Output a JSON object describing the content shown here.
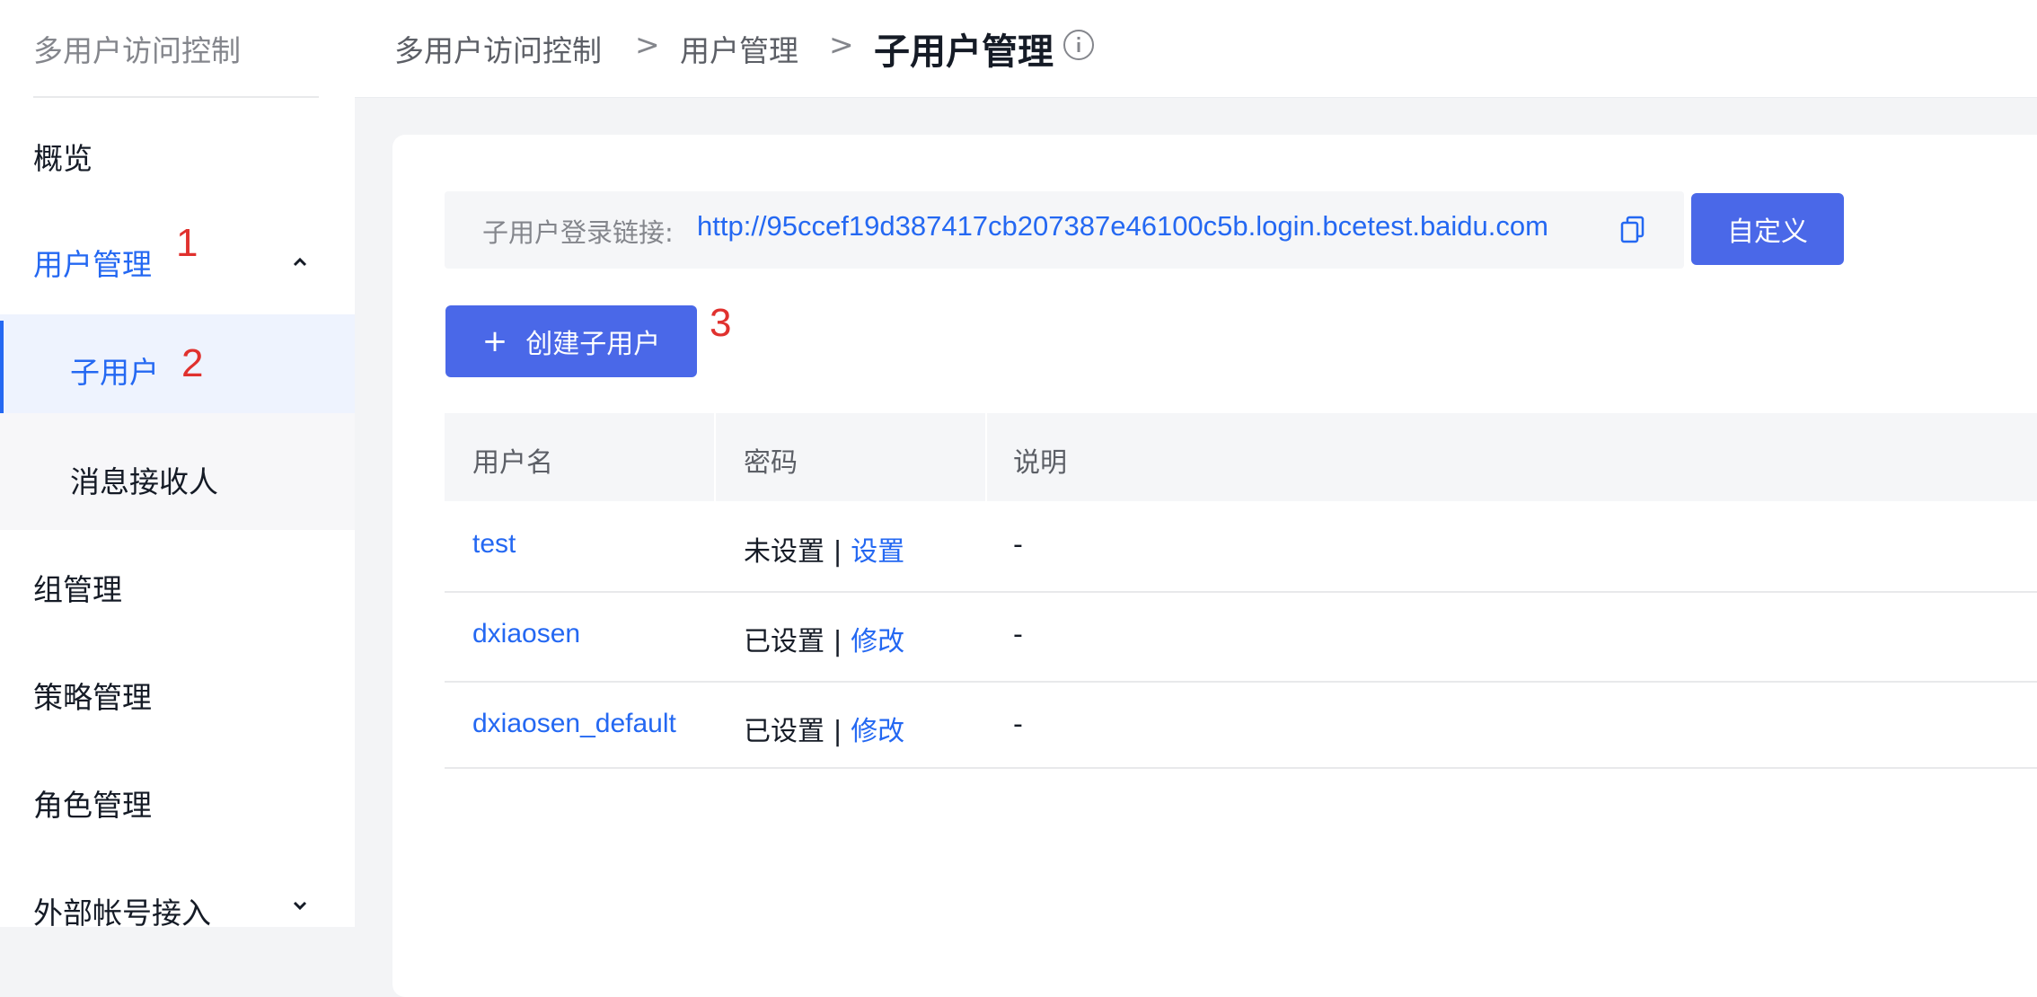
{
  "sidebar": {
    "title": "多用户访问控制",
    "items": {
      "overview": "概览",
      "user_mgmt": "用户管理",
      "sub_user": "子用户",
      "msg_receiver": "消息接收人",
      "group_mgmt": "组管理",
      "policy_mgmt": "策略管理",
      "role_mgmt": "角色管理",
      "external_account": "外部帐号接入"
    }
  },
  "annotations": {
    "a1": "1",
    "a2": "2",
    "a3": "3"
  },
  "breadcrumb": {
    "root": "多用户访问控制",
    "parent": "用户管理",
    "current": "子用户管理",
    "sep": ">"
  },
  "login_link": {
    "label": "子用户登录链接:",
    "url": "http://95ccef19d387417cb207387e46100c5b.login.bcetest.baidu.com",
    "custom_button": "自定义"
  },
  "create_button": {
    "plus": "+",
    "label": "创建子用户"
  },
  "table": {
    "headers": [
      "用户名",
      "密码",
      "说明"
    ],
    "rows": [
      {
        "username": "test",
        "pw_status": "未设置 | ",
        "pw_action": "设置",
        "desc": "-"
      },
      {
        "username": "dxiaosen",
        "pw_status": "已设置 | ",
        "pw_action": "修改",
        "desc": "-"
      },
      {
        "username": "dxiaosen_default",
        "pw_status": "已设置 | ",
        "pw_action": "修改",
        "desc": "-"
      }
    ]
  },
  "colors": {
    "accent": "#2468f2",
    "button": "#4a68e8",
    "annotation": "#e0312e"
  },
  "icons": [
    "chevron-up-icon",
    "chevron-down-icon",
    "info-icon",
    "copy-icon",
    "plus-icon"
  ]
}
